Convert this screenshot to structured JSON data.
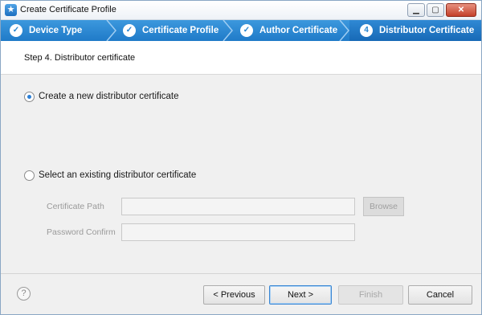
{
  "window": {
    "title": "Create Certificate Profile"
  },
  "steps": [
    {
      "label": "Device Type",
      "marker": "✓"
    },
    {
      "label": "Certificate Profile",
      "marker": "✓"
    },
    {
      "label": "Author Certificate",
      "marker": "✓"
    },
    {
      "label": "Distributor Certificate",
      "marker": "4"
    }
  ],
  "header": {
    "step_title": "Step 4. Distributor certificate"
  },
  "options": {
    "create_new": {
      "label": "Create a new distributor certificate",
      "checked": true
    },
    "select_existing": {
      "label": "Select an existing distributor certificate",
      "checked": false
    }
  },
  "fields": {
    "certificate_path": {
      "label": "Certificate Path",
      "value": ""
    },
    "password_confirm": {
      "label": "Password Confirm",
      "value": ""
    },
    "browse_label": "Browse"
  },
  "footer": {
    "help_glyph": "?",
    "previous_label": "< Previous",
    "next_label": "Next >",
    "finish_label": "Finish",
    "cancel_label": "Cancel"
  },
  "colors": {
    "step_bar": "#2583cf",
    "radio_selected": "#2b7fd6",
    "close_button": "#c4402a"
  }
}
